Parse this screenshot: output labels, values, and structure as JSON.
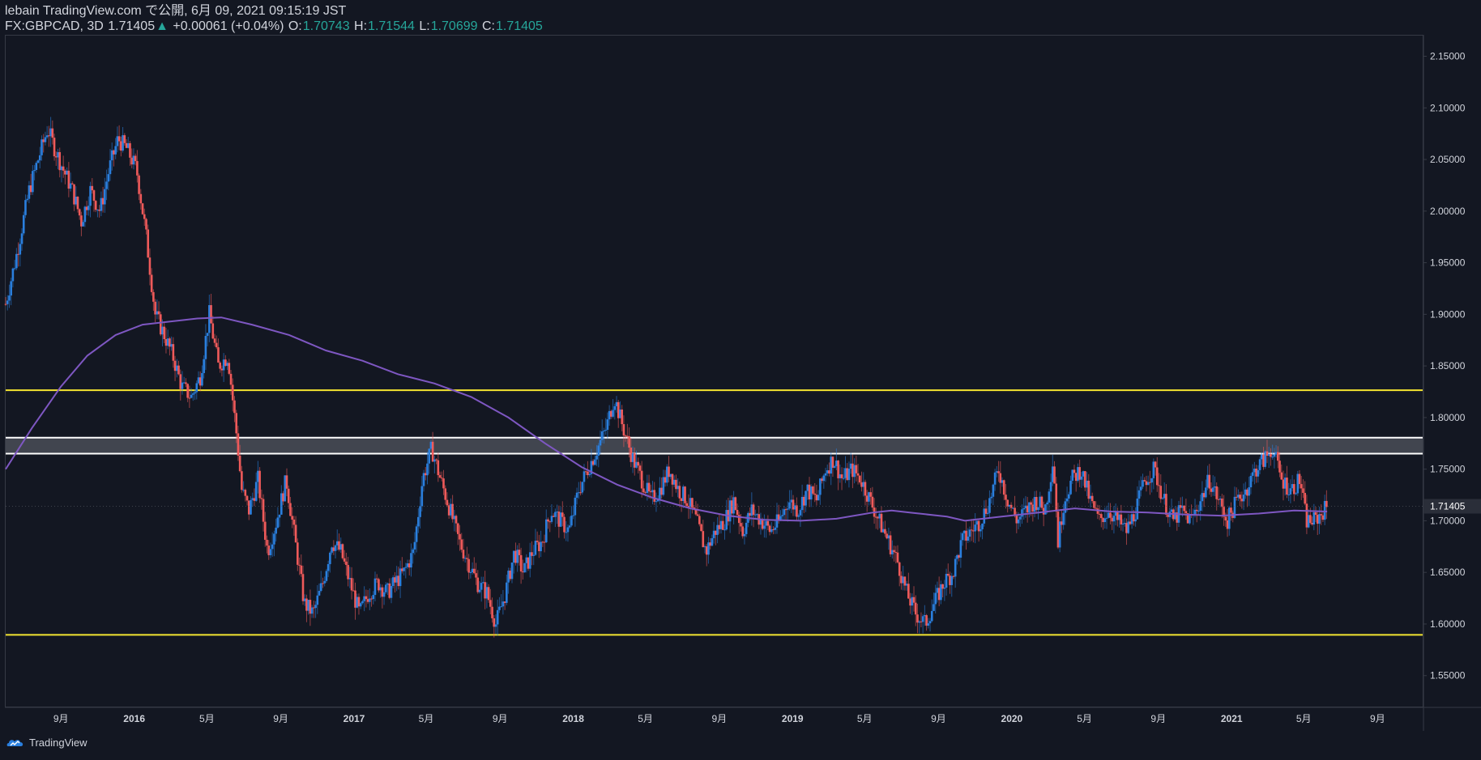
{
  "header": {
    "line1": "lebain TradingView.com で公開, 6月 09, 2021 09:15:19 JST",
    "symbol": "FX:GBPCAD, 3D",
    "last": "1.71405",
    "change_arrow": "▲",
    "change": "+0.00061 (+0.04%)",
    "o_label": "O:",
    "o_value": "1.70743",
    "h_label": "H:",
    "h_value": "1.71544",
    "l_label": "L:",
    "l_value": "1.70699",
    "c_label": "C:",
    "c_value": "1.71405"
  },
  "footer": {
    "brand": "TradingView",
    "logo_icon": "tradingview-logo-icon"
  },
  "colors": {
    "background": "#131722",
    "up": "#2a7fde",
    "down": "#ef5a5a",
    "ma": "#7e57c2",
    "support_resistance": "#f4e531",
    "zone_line": "#ffffff",
    "zone_fill": "#4a4d57",
    "axis_text": "#d1d4dc",
    "price_tag_bg": "#2a2e39"
  },
  "chart_data": {
    "type": "candlestick",
    "symbol": "FX:GBPCAD",
    "timeframe": "3D",
    "ylim": [
      1.52,
      2.17
    ],
    "y_ticks": [
      "2.15000",
      "2.10000",
      "2.05000",
      "2.00000",
      "1.95000",
      "1.90000",
      "1.85000",
      "1.80000",
      "1.75000",
      "1.70000",
      "1.65000",
      "1.60000",
      "1.55000"
    ],
    "y_tick_values": [
      2.15,
      2.1,
      2.05,
      2.0,
      1.95,
      1.9,
      1.85,
      1.8,
      1.75,
      1.7,
      1.65,
      1.6,
      1.55
    ],
    "current_price_label": "1.71405",
    "current_price": 1.71405,
    "x_ticks": [
      {
        "label": "9月",
        "date": "2015-09"
      },
      {
        "label": "2016",
        "date": "2016-01"
      },
      {
        "label": "5月",
        "date": "2016-05"
      },
      {
        "label": "9月",
        "date": "2016-09"
      },
      {
        "label": "2017",
        "date": "2017-01"
      },
      {
        "label": "5月",
        "date": "2017-05"
      },
      {
        "label": "9月",
        "date": "2017-09"
      },
      {
        "label": "2018",
        "date": "2018-01"
      },
      {
        "label": "5月",
        "date": "2018-05"
      },
      {
        "label": "9月",
        "date": "2018-09"
      },
      {
        "label": "2019",
        "date": "2019-01"
      },
      {
        "label": "5月",
        "date": "2019-05"
      },
      {
        "label": "9月",
        "date": "2019-09"
      },
      {
        "label": "2020",
        "date": "2020-01"
      },
      {
        "label": "5月",
        "date": "2020-05"
      },
      {
        "label": "9月",
        "date": "2020-09"
      },
      {
        "label": "2021",
        "date": "2021-01"
      },
      {
        "label": "5月",
        "date": "2021-05"
      },
      {
        "label": "9月",
        "date": "2021-09"
      }
    ],
    "x_range": [
      "2015-06-01",
      "2021-11-15"
    ],
    "horizontal_lines": [
      {
        "kind": "resistance",
        "value": 1.8265
      },
      {
        "kind": "support",
        "value": 1.5895
      }
    ],
    "zone": {
      "top": 1.7805,
      "bottom": 1.765
    },
    "close_path": [
      [
        "2015-06-01",
        1.91
      ],
      [
        "2015-06-20",
        1.96
      ],
      [
        "2015-07-10",
        2.02
      ],
      [
        "2015-07-25",
        2.05
      ],
      [
        "2015-08-10",
        2.08
      ],
      [
        "2015-08-22",
        2.06
      ],
      [
        "2015-09-05",
        2.04
      ],
      [
        "2015-09-20",
        2.02
      ],
      [
        "2015-10-05",
        1.99
      ],
      [
        "2015-10-20",
        2.02
      ],
      [
        "2015-11-05",
        2.0
      ],
      [
        "2015-11-20",
        2.04
      ],
      [
        "2015-12-05",
        2.07
      ],
      [
        "2015-12-20",
        2.06
      ],
      [
        "2016-01-05",
        2.04
      ],
      [
        "2016-01-20",
        1.98
      ],
      [
        "2016-02-05",
        1.9
      ],
      [
        "2016-02-20",
        1.88
      ],
      [
        "2016-03-05",
        1.86
      ],
      [
        "2016-03-20",
        1.83
      ],
      [
        "2016-04-05",
        1.82
      ],
      [
        "2016-04-20",
        1.84
      ],
      [
        "2016-05-05",
        1.9
      ],
      [
        "2016-05-20",
        1.85
      ],
      [
        "2016-06-05",
        1.86
      ],
      [
        "2016-06-20",
        1.78
      ],
      [
        "2016-06-28",
        1.73
      ],
      [
        "2016-07-10",
        1.71
      ],
      [
        "2016-07-25",
        1.74
      ],
      [
        "2016-08-10",
        1.67
      ],
      [
        "2016-08-25",
        1.7
      ],
      [
        "2016-09-10",
        1.74
      ],
      [
        "2016-09-25",
        1.68
      ],
      [
        "2016-10-10",
        1.62
      ],
      [
        "2016-10-25",
        1.61
      ],
      [
        "2016-11-10",
        1.64
      ],
      [
        "2016-11-25",
        1.68
      ],
      [
        "2016-12-10",
        1.67
      ],
      [
        "2016-12-25",
        1.64
      ],
      [
        "2017-01-10",
        1.61
      ],
      [
        "2017-01-25",
        1.63
      ],
      [
        "2017-02-10",
        1.64
      ],
      [
        "2017-02-25",
        1.63
      ],
      [
        "2017-03-10",
        1.64
      ],
      [
        "2017-03-25",
        1.65
      ],
      [
        "2017-04-10",
        1.67
      ],
      [
        "2017-04-25",
        1.74
      ],
      [
        "2017-05-10",
        1.77
      ],
      [
        "2017-05-25",
        1.74
      ],
      [
        "2017-06-10",
        1.71
      ],
      [
        "2017-06-25",
        1.68
      ],
      [
        "2017-07-10",
        1.66
      ],
      [
        "2017-07-25",
        1.64
      ],
      [
        "2017-08-10",
        1.63
      ],
      [
        "2017-08-25",
        1.6
      ],
      [
        "2017-09-10",
        1.63
      ],
      [
        "2017-09-25",
        1.67
      ],
      [
        "2017-10-10",
        1.65
      ],
      [
        "2017-10-25",
        1.67
      ],
      [
        "2017-11-10",
        1.68
      ],
      [
        "2017-11-25",
        1.71
      ],
      [
        "2017-12-10",
        1.7
      ],
      [
        "2017-12-25",
        1.69
      ],
      [
        "2018-01-10",
        1.73
      ],
      [
        "2018-01-25",
        1.75
      ],
      [
        "2018-02-10",
        1.77
      ],
      [
        "2018-02-25",
        1.79
      ],
      [
        "2018-03-10",
        1.82
      ],
      [
        "2018-03-25",
        1.79
      ],
      [
        "2018-04-10",
        1.76
      ],
      [
        "2018-04-25",
        1.74
      ],
      [
        "2018-05-10",
        1.72
      ],
      [
        "2018-05-25",
        1.73
      ],
      [
        "2018-06-10",
        1.75
      ],
      [
        "2018-06-25",
        1.73
      ],
      [
        "2018-07-10",
        1.72
      ],
      [
        "2018-07-25",
        1.7
      ],
      [
        "2018-08-10",
        1.67
      ],
      [
        "2018-08-25",
        1.69
      ],
      [
        "2018-09-10",
        1.7
      ],
      [
        "2018-09-25",
        1.72
      ],
      [
        "2018-10-10",
        1.69
      ],
      [
        "2018-10-25",
        1.71
      ],
      [
        "2018-11-10",
        1.7
      ],
      [
        "2018-11-25",
        1.69
      ],
      [
        "2018-12-10",
        1.7
      ],
      [
        "2018-12-25",
        1.72
      ],
      [
        "2019-01-10",
        1.71
      ],
      [
        "2019-01-25",
        1.73
      ],
      [
        "2019-02-10",
        1.72
      ],
      [
        "2019-02-25",
        1.75
      ],
      [
        "2019-03-10",
        1.76
      ],
      [
        "2019-03-25",
        1.74
      ],
      [
        "2019-04-10",
        1.75
      ],
      [
        "2019-04-25",
        1.74
      ],
      [
        "2019-05-10",
        1.72
      ],
      [
        "2019-05-25",
        1.7
      ],
      [
        "2019-06-10",
        1.68
      ],
      [
        "2019-06-25",
        1.66
      ],
      [
        "2019-07-10",
        1.63
      ],
      [
        "2019-07-25",
        1.61
      ],
      [
        "2019-08-10",
        1.6
      ],
      [
        "2019-08-25",
        1.62
      ],
      [
        "2019-09-10",
        1.64
      ],
      [
        "2019-09-25",
        1.65
      ],
      [
        "2019-10-10",
        1.68
      ],
      [
        "2019-10-25",
        1.69
      ],
      [
        "2019-11-10",
        1.7
      ],
      [
        "2019-11-25",
        1.72
      ],
      [
        "2019-12-10",
        1.75
      ],
      [
        "2019-12-25",
        1.72
      ],
      [
        "2020-01-10",
        1.7
      ],
      [
        "2020-01-25",
        1.71
      ],
      [
        "2020-02-10",
        1.72
      ],
      [
        "2020-02-25",
        1.71
      ],
      [
        "2020-03-10",
        1.76
      ],
      [
        "2020-03-18",
        1.68
      ],
      [
        "2020-03-28",
        1.72
      ],
      [
        "2020-04-10",
        1.74
      ],
      [
        "2020-04-25",
        1.75
      ],
      [
        "2020-05-10",
        1.72
      ],
      [
        "2020-05-25",
        1.7
      ],
      [
        "2020-06-10",
        1.71
      ],
      [
        "2020-06-25",
        1.7
      ],
      [
        "2020-07-10",
        1.69
      ],
      [
        "2020-07-25",
        1.71
      ],
      [
        "2020-08-10",
        1.74
      ],
      [
        "2020-08-25",
        1.75
      ],
      [
        "2020-09-10",
        1.72
      ],
      [
        "2020-09-25",
        1.7
      ],
      [
        "2020-10-10",
        1.71
      ],
      [
        "2020-10-25",
        1.7
      ],
      [
        "2020-11-10",
        1.72
      ],
      [
        "2020-11-25",
        1.74
      ],
      [
        "2020-12-10",
        1.72
      ],
      [
        "2020-12-25",
        1.7
      ],
      [
        "2021-01-10",
        1.72
      ],
      [
        "2021-01-25",
        1.73
      ],
      [
        "2021-02-10",
        1.75
      ],
      [
        "2021-02-25",
        1.76
      ],
      [
        "2021-03-10",
        1.77
      ],
      [
        "2021-03-25",
        1.74
      ],
      [
        "2021-04-10",
        1.73
      ],
      [
        "2021-04-25",
        1.74
      ],
      [
        "2021-05-05",
        1.7
      ],
      [
        "2021-05-20",
        1.7
      ],
      [
        "2021-06-09",
        1.714
      ]
    ],
    "ma_path": [
      [
        "2015-06-01",
        1.75
      ],
      [
        "2015-07-15",
        1.79
      ],
      [
        "2015-09-01",
        1.83
      ],
      [
        "2015-10-15",
        1.86
      ],
      [
        "2015-12-01",
        1.88
      ],
      [
        "2016-01-15",
        1.89
      ],
      [
        "2016-03-01",
        1.893
      ],
      [
        "2016-04-15",
        1.896
      ],
      [
        "2016-05-25",
        1.897
      ],
      [
        "2016-07-15",
        1.89
      ],
      [
        "2016-09-15",
        1.88
      ],
      [
        "2016-11-15",
        1.865
      ],
      [
        "2017-01-15",
        1.855
      ],
      [
        "2017-03-15",
        1.842
      ],
      [
        "2017-05-15",
        1.833
      ],
      [
        "2017-07-15",
        1.82
      ],
      [
        "2017-09-15",
        1.8
      ],
      [
        "2017-11-15",
        1.775
      ],
      [
        "2018-01-15",
        1.752
      ],
      [
        "2018-03-15",
        1.735
      ],
      [
        "2018-05-15",
        1.722
      ],
      [
        "2018-07-15",
        1.712
      ],
      [
        "2018-09-15",
        1.705
      ],
      [
        "2018-11-15",
        1.701
      ],
      [
        "2019-01-15",
        1.7
      ],
      [
        "2019-03-15",
        1.702
      ],
      [
        "2019-05-15",
        1.708
      ],
      [
        "2019-06-15",
        1.71
      ],
      [
        "2019-07-15",
        1.708
      ],
      [
        "2019-09-15",
        1.704
      ],
      [
        "2019-10-15",
        1.7
      ],
      [
        "2019-12-15",
        1.704
      ],
      [
        "2020-02-15",
        1.708
      ],
      [
        "2020-04-15",
        1.712
      ],
      [
        "2020-06-15",
        1.709
      ],
      [
        "2020-08-15",
        1.708
      ],
      [
        "2020-10-15",
        1.706
      ],
      [
        "2020-12-15",
        1.705
      ],
      [
        "2021-02-15",
        1.707
      ],
      [
        "2021-04-15",
        1.71
      ],
      [
        "2021-06-09",
        1.709
      ]
    ]
  }
}
